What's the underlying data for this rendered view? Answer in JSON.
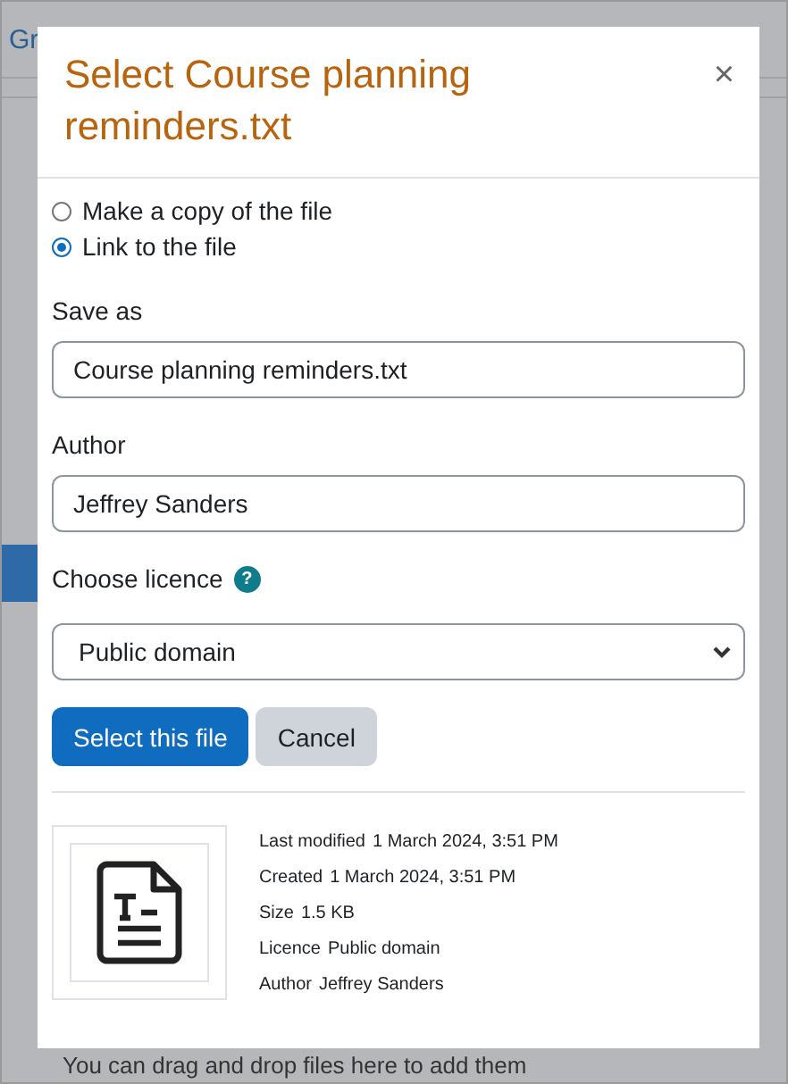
{
  "background": {
    "nav_text": "Gr",
    "drop_hint": "You can drag and drop files here to add them"
  },
  "dialog": {
    "title": "Select Course planning reminders.txt",
    "close": "×",
    "options": [
      {
        "label": "Make a copy of the file",
        "selected": false
      },
      {
        "label": "Link to the file",
        "selected": true
      }
    ],
    "save_as": {
      "label": "Save as",
      "value": "Course planning reminders.txt"
    },
    "author": {
      "label": "Author",
      "value": "Jeffrey Sanders"
    },
    "licence": {
      "label": "Choose licence",
      "help": "?",
      "value": "Public domain"
    },
    "buttons": [
      {
        "label": "Select this file",
        "kind": "primary"
      },
      {
        "label": "Cancel",
        "kind": "secondary"
      }
    ],
    "details": [
      {
        "label": "Last modified",
        "value": "1 March 2024, 3:51 PM"
      },
      {
        "label": "Created",
        "value": "1 March 2024, 3:51 PM"
      },
      {
        "label": "Size",
        "value": "1.5 KB"
      },
      {
        "label": "Licence",
        "value": "Public domain"
      },
      {
        "label": "Author",
        "value": "Jeffrey Sanders"
      }
    ]
  }
}
